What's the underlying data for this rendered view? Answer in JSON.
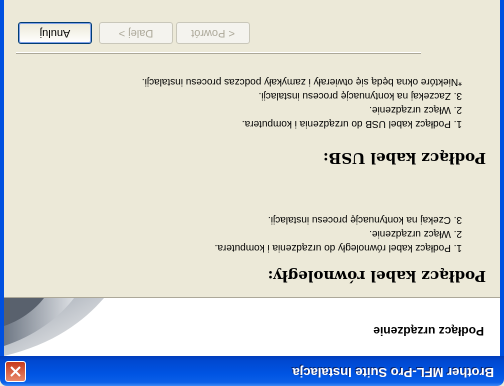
{
  "window": {
    "title": "Brother MFL-Pro Suite Instalacja"
  },
  "header": {
    "title": "Podłącz urządzenie"
  },
  "parallel": {
    "heading": "Podłącz kabel równoległy:",
    "steps": [
      "1. Podłącz kabel równoległy do urządzenia i komputera.",
      "2. Włącz urządzenie.",
      "3. Czekaj na kontynuację procesu instalacji."
    ]
  },
  "usb": {
    "heading": "Podłącz kabel USB:",
    "steps": [
      "1. Podłącz kabel USB do urządzenia i komputera.",
      "2. Włącz urządzenie.",
      "3. Zaczekaj na kontynuację procesu instalacji.",
      "*Niektóre okna będą się otwierały i zamykały podczas procesu instalacji."
    ]
  },
  "buttons": {
    "back": "< Powrót",
    "next": "Dalej >",
    "cancel": "Anuluj"
  }
}
